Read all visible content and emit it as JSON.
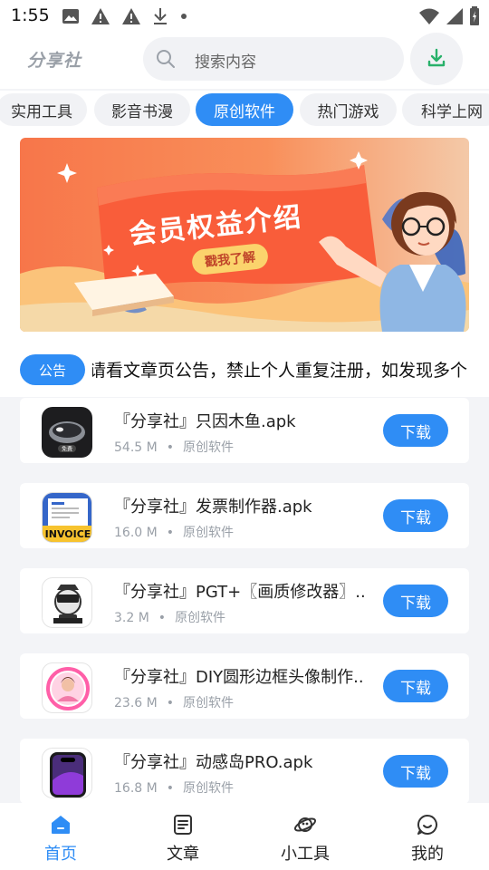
{
  "status_bar": {
    "time": "1:55"
  },
  "header": {
    "logo": "分享社",
    "search_placeholder": "搜索内容"
  },
  "categories": [
    "实用工具",
    "影音书漫",
    "原创软件",
    "热门游戏",
    "科学上网"
  ],
  "active_category": "原创软件",
  "banner": {
    "title": "会员权益介绍",
    "cta": "戳我了解"
  },
  "notice": {
    "label": "公告",
    "text": "请看文章页公告，禁止个人重复注册，如发现多个"
  },
  "apps": [
    {
      "name": "『分享社』只因木鱼.apk",
      "size": "54.5 M",
      "category": "原创软件",
      "button": "下载",
      "icon": "wooden-fish-icon"
    },
    {
      "name": "『分享社』发票制作器.apk",
      "size": "16.0 M",
      "category": "原创软件",
      "button": "下载",
      "icon": "invoice-icon",
      "icon_text": "INVOICE"
    },
    {
      "name": "『分享社』PGT+〖画质修改器〗..",
      "size": "3.2 M",
      "category": "原创软件",
      "button": "下载",
      "icon": "pgt-helmet-icon"
    },
    {
      "name": "『分享社』DIY圆形边框头像制作..",
      "size": "23.6 M",
      "category": "原创软件",
      "button": "下载",
      "icon": "avatar-frame-icon"
    },
    {
      "name": "『分享社』动感岛PRO.apk",
      "size": "16.8 M",
      "category": "原创软件",
      "button": "下载",
      "icon": "dynamic-island-phone-icon"
    }
  ],
  "bottom_nav": [
    {
      "label": "首页",
      "icon": "home-icon",
      "active": true
    },
    {
      "label": "文章",
      "icon": "article-icon",
      "active": false
    },
    {
      "label": "小工具",
      "icon": "planet-icon",
      "active": false
    },
    {
      "label": "我的",
      "icon": "profile-icon",
      "active": false
    }
  ],
  "colors": {
    "accent": "#2f8df5",
    "banner_orange": "#f7764a",
    "text_muted": "#9aa0a8"
  }
}
